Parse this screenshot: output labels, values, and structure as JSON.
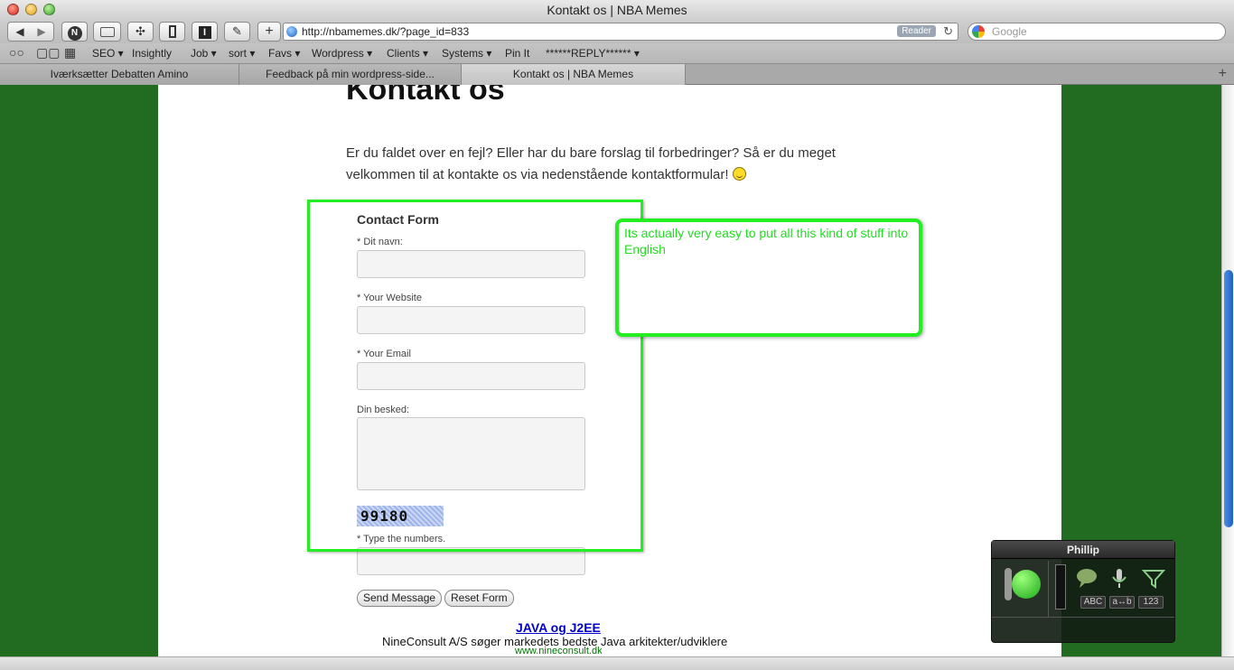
{
  "window": {
    "title": "Kontakt os | NBA Memes"
  },
  "toolbar": {
    "url": "http://nbamemes.dk/?page_id=833",
    "reader_label": "Reader",
    "search_placeholder": "Google"
  },
  "bookmarks": [
    {
      "label": "SEO ▾"
    },
    {
      "label": "Insightly"
    },
    {
      "label": "Job ▾"
    },
    {
      "label": "sort ▾"
    },
    {
      "label": "Favs ▾"
    },
    {
      "label": "Wordpress ▾"
    },
    {
      "label": "Clients ▾"
    },
    {
      "label": "Systems ▾"
    },
    {
      "label": "Pin It"
    },
    {
      "label": "******REPLY****** ▾"
    }
  ],
  "tabs": [
    {
      "label": "Iværksætter Debatten Amino"
    },
    {
      "label": "Feedback på min wordpress-side..."
    },
    {
      "label": "Kontakt os | NBA Memes"
    }
  ],
  "page": {
    "title": "Kontakt os",
    "intro_line1": "Er du faldet over en fejl? Eller har du bare forslag til forbedringer? Så er du meget",
    "intro_line2": "velkommen til at kontakte os via nedenstående kontaktformular!",
    "form": {
      "title": "Contact Form",
      "name_label": "* Dit navn:",
      "website_label": "* Your Website",
      "email_label": "* Your Email",
      "message_label": "Din besked:",
      "captcha_code": "99180",
      "captcha_label": "* Type the numbers.",
      "send_label": "Send Message",
      "reset_label": "Reset Form"
    },
    "annotation": "Its actually very easy to  put all this kind of stuff into English",
    "ad": {
      "title": "JAVA og J2EE",
      "text": "NineConsult A/S søger markedets bedste Java arkitekter/udviklere",
      "url": "www.nineconsult.dk"
    }
  },
  "dictation": {
    "user": "Phillip",
    "keys": [
      "ABC",
      "a↔b",
      "123"
    ]
  },
  "colors": {
    "site_background": "#226c22",
    "annotation_green": "#22ee22"
  }
}
